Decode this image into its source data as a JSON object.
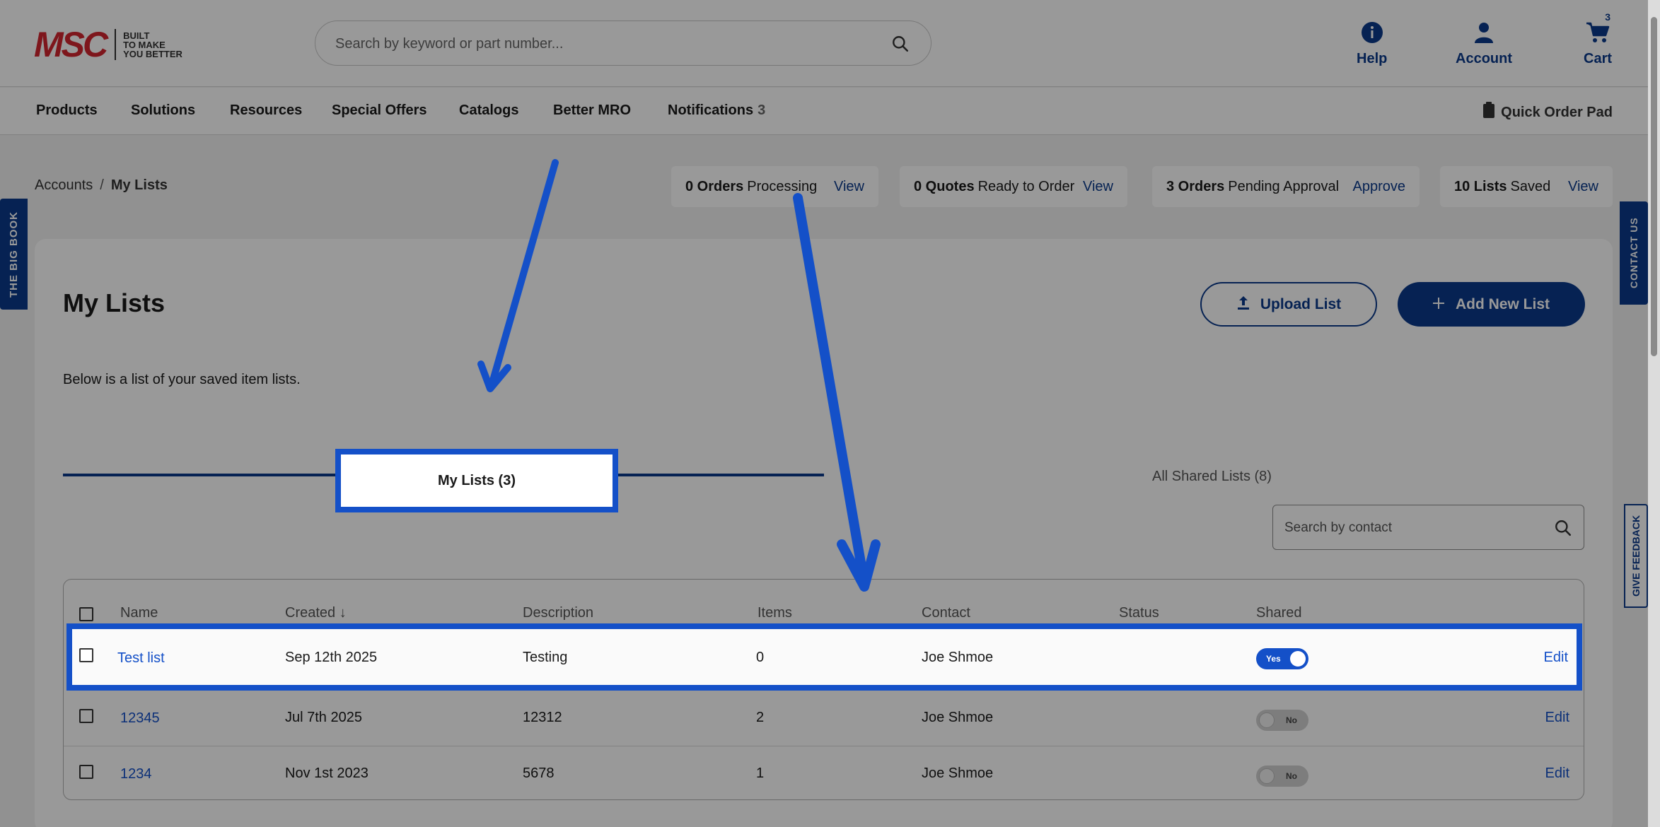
{
  "header": {
    "logo_text": "MSC",
    "tagline_1": "BUILT",
    "tagline_2": "TO MAKE",
    "tagline_3": "YOU BETTER",
    "search_placeholder": "Search by keyword or part number...",
    "help_label": "Help",
    "account_label": "Account",
    "cart_label": "Cart",
    "cart_count": "3"
  },
  "nav": {
    "items": [
      "Products",
      "Solutions",
      "Resources",
      "Special Offers",
      "Catalogs",
      "Better MRO",
      "Notifications"
    ],
    "notifications_count": "3",
    "quick_order": "Quick Order Pad"
  },
  "breadcrumb": {
    "parent": "Accounts",
    "separator": "/",
    "current": "My Lists"
  },
  "status": [
    {
      "count": "0 Orders",
      "text": "Processing",
      "link": "View"
    },
    {
      "count": "0 Quotes",
      "text": "Ready to Order",
      "link": "View"
    },
    {
      "count": "3 Orders",
      "text": "Pending Approval",
      "link": "Approve"
    },
    {
      "count": "10 Lists",
      "text": "Saved",
      "link": "View"
    }
  ],
  "side": {
    "big_book": "THE BIG BOOK",
    "contact": "CONTACT US",
    "feedback": "GIVE FEEDBACK"
  },
  "page": {
    "title": "My Lists",
    "subtitle": "Below is a list of your saved item lists.",
    "upload_label": "Upload List",
    "add_label": "Add New List"
  },
  "tabs": {
    "mine": "My Lists (3)",
    "shared": "All Shared Lists (8)"
  },
  "contact_search_placeholder": "Search by contact",
  "table": {
    "headers": {
      "name": "Name",
      "created": "Created",
      "description": "Description",
      "items": "Items",
      "contact": "Contact",
      "status": "Status",
      "shared": "Shared"
    },
    "rows": [
      {
        "name": "Test list",
        "created": "Sep 12th 2025",
        "description": "Testing",
        "items": "0",
        "contact": "Joe Shmoe",
        "status": "",
        "shared": "Yes",
        "edit": "Edit"
      },
      {
        "name": "12345",
        "created": "Jul 7th 2025",
        "description": "12312",
        "items": "2",
        "contact": "Joe Shmoe",
        "status": "",
        "shared": "No",
        "edit": "Edit"
      },
      {
        "name": "1234",
        "created": "Nov 1st 2023",
        "description": "5678",
        "items": "1",
        "contact": "Joe Shmoe",
        "status": "",
        "shared": "No",
        "edit": "Edit"
      }
    ]
  },
  "colors": {
    "brand_blue": "#0a3a8a",
    "highlight_blue": "#1450c8",
    "logo_red": "#d22630"
  }
}
